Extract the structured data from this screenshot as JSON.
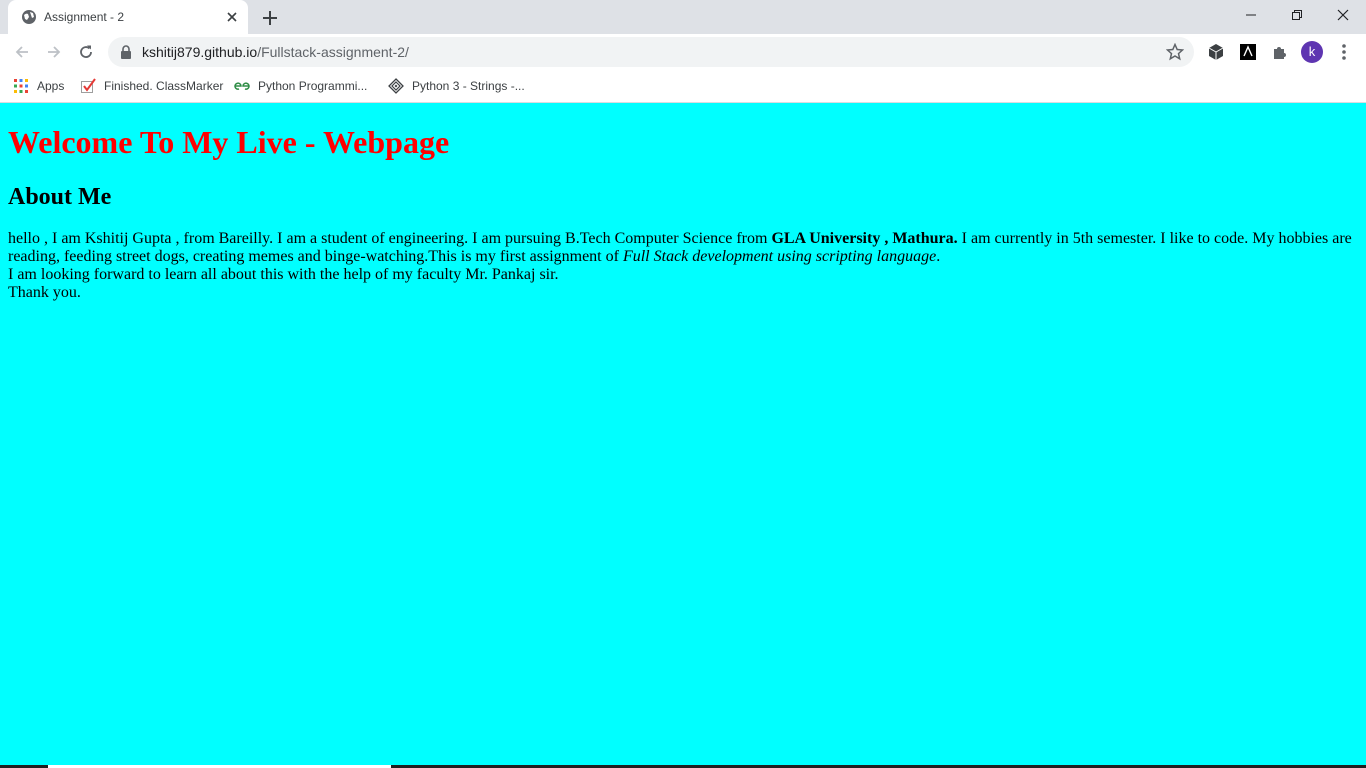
{
  "browser": {
    "tab": {
      "title": "Assignment - 2",
      "favicon_icon": "globe-icon"
    },
    "address_bar": {
      "domain": "kshitij879.github.io",
      "path": "/Fullstack-assignment-2/"
    },
    "profile_initial": "k",
    "profile_color": "#5e35b1",
    "bookmarks": [
      {
        "label": "Apps",
        "icon": "apps-grid-icon"
      },
      {
        "label": "Finished. ClassMarker",
        "icon": "checkbox-icon"
      },
      {
        "label": "Python Programmi...",
        "icon": "gfg-icon"
      },
      {
        "label": "Python 3 - Strings -...",
        "icon": "diamond-icon"
      }
    ]
  },
  "page": {
    "background": "#00ffff",
    "heading": "Welcome To My Live - Webpage",
    "heading_color": "#ff0000",
    "subheading": "About Me",
    "paragraph": {
      "intro": "hello , I am Kshitij Gupta , from Bareilly. I am a student of engineering. I am pursuing B.Tech Computer Science from ",
      "university": "GLA University , Mathura.",
      "middle": " I am currently in 5th semester. I like to code. My hobbies are reading, feeding street dogs, creating memes and binge-watching.This is my first assignment of ",
      "course": "Full Stack development using scripting language",
      "end": ".",
      "line2": "I am looking forward to learn all about this with the help of my faculty Mr. Pankaj sir.",
      "line3": "Thank you."
    }
  }
}
